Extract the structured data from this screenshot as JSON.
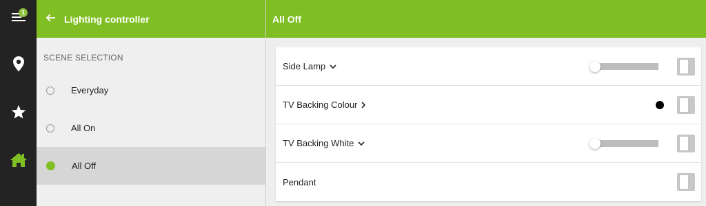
{
  "app": {
    "badge_count": "1",
    "accent_color": "#80bf23",
    "rail_icons": [
      "menu-icon",
      "location-pin-icon",
      "star-icon",
      "home-icon"
    ]
  },
  "header": {
    "panel_title": "Lighting controller",
    "scene_title": "All Off"
  },
  "scenes": {
    "section_label": "SCENE SELECTION",
    "items": [
      {
        "label": "Everyday",
        "selected": false
      },
      {
        "label": "All On",
        "selected": false
      },
      {
        "label": "All Off",
        "selected": true
      }
    ]
  },
  "devices": [
    {
      "label": "Side Lamp",
      "expander": "chevron-down-icon",
      "control": "slider",
      "level": 0,
      "on": false
    },
    {
      "label": "TV Backing Colour",
      "expander": "chevron-right-icon",
      "control": "colour",
      "colour": "#000000",
      "on": false
    },
    {
      "label": "TV Backing White",
      "expander": "chevron-down-icon",
      "control": "slider",
      "level": 0,
      "on": false
    },
    {
      "label": "Pendant",
      "expander": "",
      "control": "switch",
      "on": false
    }
  ]
}
